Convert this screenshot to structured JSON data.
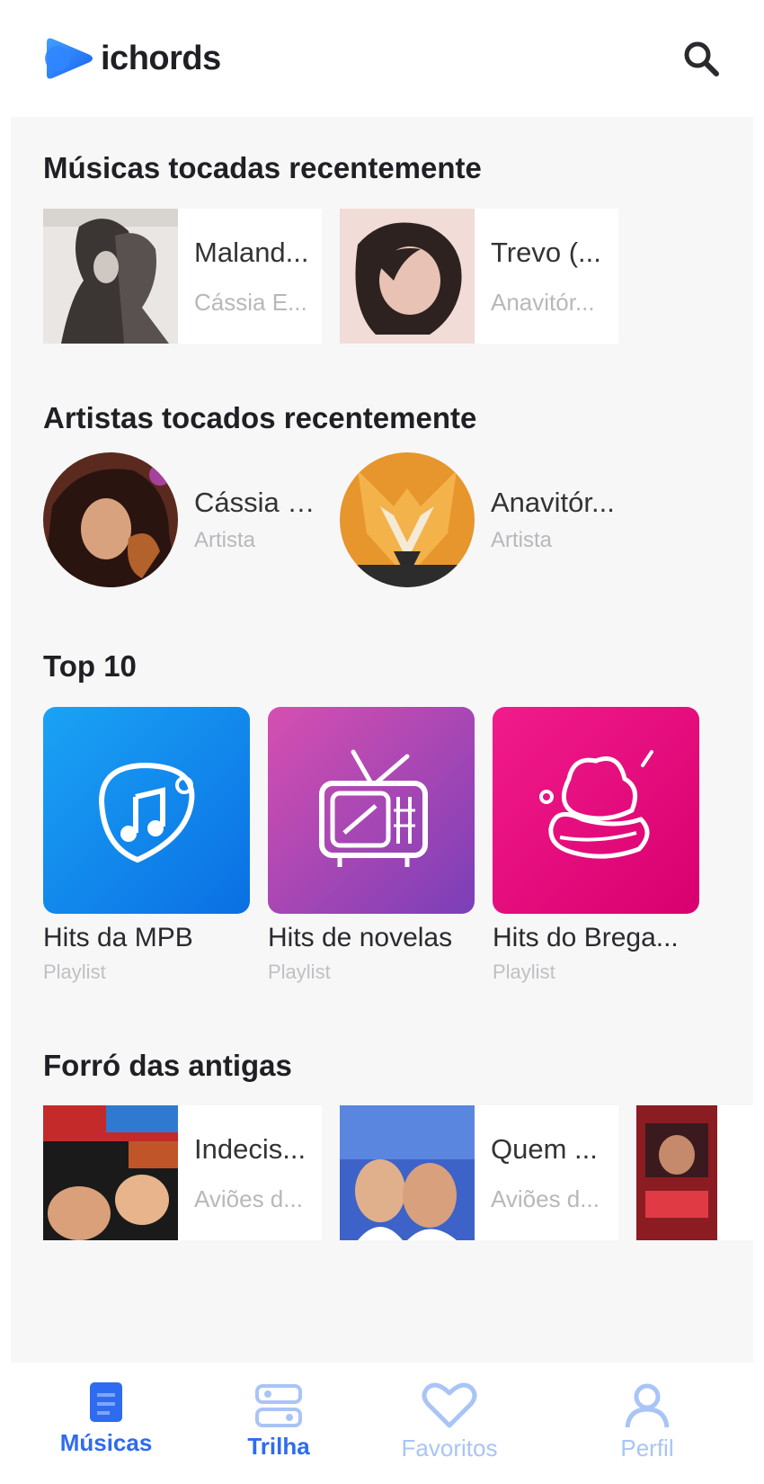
{
  "app": {
    "name": "ichords"
  },
  "colors": {
    "accent": "#2f6bf0",
    "accent_light": "#a9c4f6",
    "background": "#f7f7f8"
  },
  "header": {
    "search_icon": "search-icon"
  },
  "recent_songs": {
    "title": "Músicas tocadas recentemente",
    "items": [
      {
        "title": "Maland...",
        "artist": "Cássia E..."
      },
      {
        "title": "Trevo (...",
        "artist": "Anavitór..."
      }
    ]
  },
  "recent_artists": {
    "title": "Artistas tocados recentemente",
    "items": [
      {
        "name": "Cássia E...",
        "type": "Artista"
      },
      {
        "name": "Anavitór...",
        "type": "Artista"
      }
    ]
  },
  "top10": {
    "title": "Top 10",
    "items": [
      {
        "label": "Hits da MPB",
        "type": "Playlist",
        "icon": "guitar-pick-music-icon"
      },
      {
        "label": "Hits de novelas",
        "type": "Playlist",
        "icon": "tv-icon"
      },
      {
        "label": "Hits do Brega...",
        "type": "Playlist",
        "icon": "heart-lips-icon"
      }
    ]
  },
  "forro": {
    "title": "Forró das antigas",
    "items": [
      {
        "title": "Indecis...",
        "artist": "Aviões d..."
      },
      {
        "title": "Quem ...",
        "artist": "Aviões d..."
      }
    ]
  },
  "nav": {
    "items": [
      {
        "label": "Músicas",
        "icon": "music-file-icon",
        "active": true
      },
      {
        "label": "Trilha",
        "icon": "trail-icon",
        "active": false
      },
      {
        "label": "Favoritos",
        "icon": "heart-icon",
        "active": false
      },
      {
        "label": "Perfil",
        "icon": "user-icon",
        "active": false
      }
    ]
  }
}
